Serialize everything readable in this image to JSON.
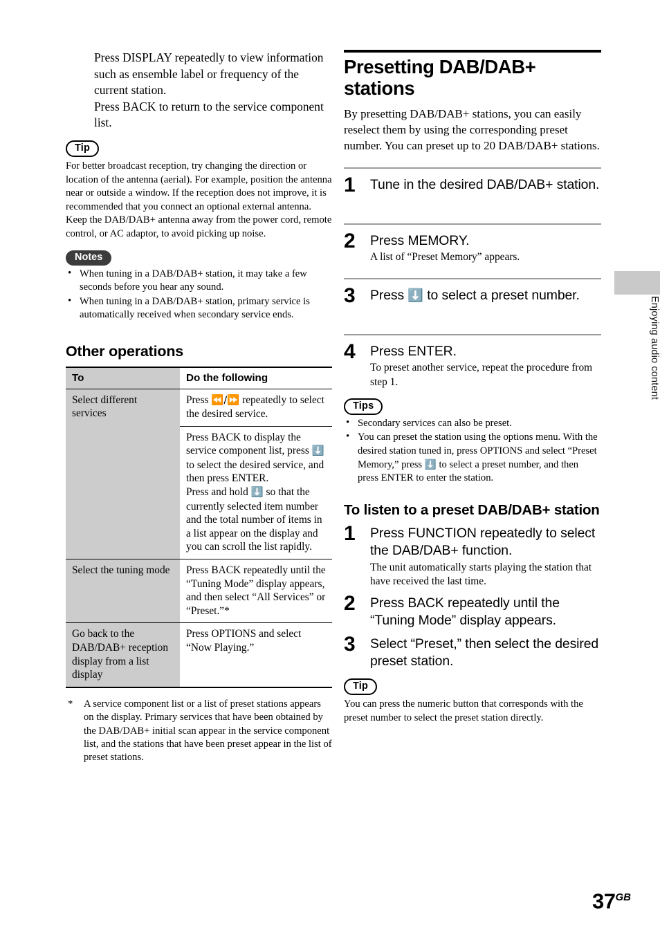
{
  "page": {
    "number": "37",
    "region_code": "GB",
    "edge_tab_label": "Enjoying audio content"
  },
  "left_column": {
    "lead_paragraph": "Press DISPLAY repeatedly to view information such as ensemble label or frequency of the current station.\nPress BACK to return to the service component list.",
    "lead_line_1": "Press DISPLAY repeatedly to view information such as ensemble label or frequency of the current station.",
    "lead_line_2": "Press BACK to return to the service component list.",
    "tip": {
      "badge": "Tip",
      "text": "For better broadcast reception, try changing the direction or location of the antenna (aerial). For example, position the antenna near or outside a window. If the reception does not improve, it is recommended that you connect an optional external antenna. Keep the DAB/DAB+ antenna away from the power cord, remote control, or AC adaptor, to avoid picking up noise."
    },
    "notes": {
      "badge": "Notes",
      "items": [
        "When tuning in a DAB/DAB+ station, it may take a few seconds before you hear any sound.",
        "When tuning in a DAB/DAB+ station, primary service is automatically received when secondary service ends."
      ]
    },
    "other_operations": {
      "heading": "Other operations",
      "columns": [
        "To",
        "Do the following"
      ],
      "rows": [
        {
          "to": "Select different services",
          "do": "Press ⏮/⏭ repeatedly to select the desired service.",
          "do_prefix": "Press ",
          "do_suffix": " repeatedly to select the desired service."
        },
        {
          "to": "",
          "do": "Press BACK to display the service component list, press ⬆/⬇ to select the desired service, and then press ENTER.\nPress and hold ⬆/⬇ so that the currently selected item number and the total number of items in a list appear on the display and you can scroll the list rapidly.",
          "do_part_1a": "Press BACK to display the service component list, press ",
          "do_part_1b": " to select the desired service, and then press ENTER.",
          "do_part_2a": "Press and hold ",
          "do_part_2b": " so that the currently selected item number and the total number of items in a list appear on the display and you can scroll the list rapidly."
        },
        {
          "to": "Select the tuning mode",
          "do": "Press BACK repeatedly until the “Tuning Mode” display appears, and then select “All Services” or “Preset.”*"
        },
        {
          "to": "Go back to the DAB/DAB+ reception display from a list display",
          "do": "Press OPTIONS and select “Now Playing.”"
        }
      ],
      "footnote_marker": "*",
      "footnote": "A service component list or a list of preset stations appears on the display. Primary services that have been obtained by the DAB/DAB+ initial scan appear in the service component list, and the stations that have been preset appear in the list of preset stations."
    }
  },
  "right_column": {
    "chapter_heading": "Presetting DAB/DAB+ stations",
    "intro": "By presetting DAB/DAB+ stations, you can easily reselect them by using the corresponding preset number. You can preset up to 20 DAB/DAB+ stations.",
    "steps": [
      {
        "num": "1",
        "title": "Tune in the desired DAB/DAB+ station.",
        "desc": ""
      },
      {
        "num": "2",
        "title": "Press MEMORY.",
        "desc": "A list of “Preset Memory” appears."
      },
      {
        "num": "3",
        "title_a": "Press ",
        "title_b": " to select a preset number.",
        "title": "Press ⬆/⬇ to select a preset number.",
        "desc": ""
      },
      {
        "num": "4",
        "title": "Press ENTER.",
        "desc": "To preset another service, repeat the procedure from step 1."
      }
    ],
    "tips": {
      "badge": "Tips",
      "items": [
        "Secondary services can also be preset.",
        "You can preset the station using the options menu. With the desired station tuned in, press OPTIONS and select “Preset Memory,” press ⬆/⬇ to select a preset number, and then press ENTER to enter the station."
      ],
      "item_2a": "You can preset the station using the options menu. With the desired station tuned in, press OPTIONS and select “Preset Memory,” press ",
      "item_2b": " to select a preset number, and then press ENTER to enter the station."
    },
    "listen_section": {
      "heading": "To listen to a preset DAB/DAB+ station",
      "steps": [
        {
          "num": "1",
          "title": "Press FUNCTION repeatedly to select the DAB/DAB+ function.",
          "desc": "The unit automatically starts playing the station that have received the last time."
        },
        {
          "num": "2",
          "title": "Press BACK repeatedly until the “Tuning Mode” display appears.",
          "desc": ""
        },
        {
          "num": "3",
          "title": "Select “Preset,” then select the desired preset station.",
          "desc": ""
        }
      ]
    },
    "final_tip": {
      "badge": "Tip",
      "text": "You can press the numeric button that corresponds with the preset number to select the preset station directly."
    }
  },
  "glyphs": {
    "prev_next": "◀◀ / ▶▶",
    "up_down": "⬆/⬇"
  }
}
